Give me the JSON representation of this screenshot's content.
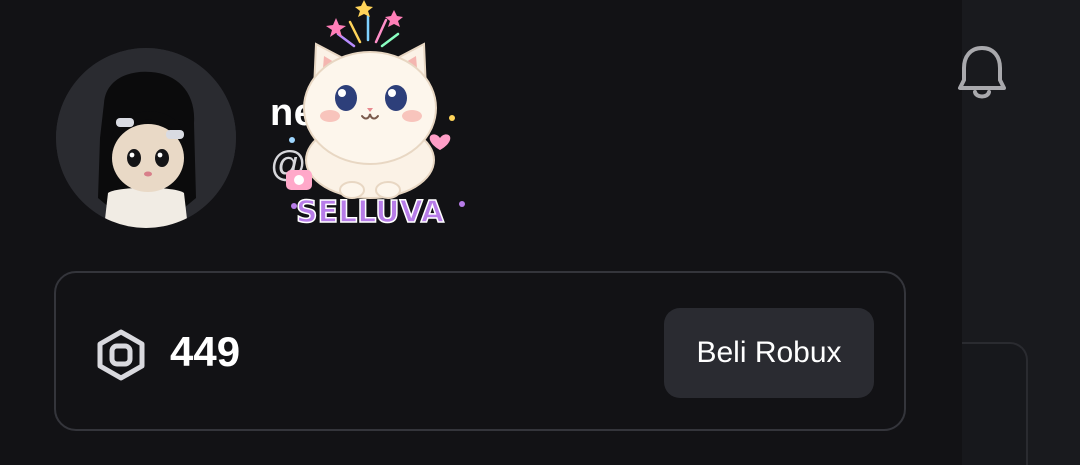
{
  "profile": {
    "display_name": "ne",
    "username": "@…niee"
  },
  "sticker": {
    "text": "SELLUVA"
  },
  "robux": {
    "icon": "robux-icon",
    "amount": "449",
    "buy_label": "Beli Robux"
  },
  "topbar": {
    "notification_icon": "bell-icon"
  },
  "colors": {
    "background": "#121215",
    "card_border": "#34353b",
    "button_bg": "#2a2b31",
    "sticker_text": "#b77ce8"
  }
}
